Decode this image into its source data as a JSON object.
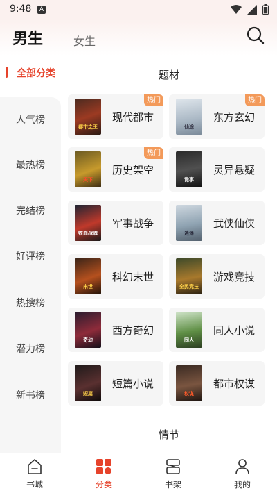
{
  "status_bar": {
    "time": "9:48",
    "notification_icon": "A"
  },
  "header": {
    "tab_male": "男生",
    "tab_female": "女生",
    "search_icon": "search-icon"
  },
  "sidebar": {
    "active_label": "全部分类",
    "items": [
      "人气榜",
      "最热榜",
      "完结榜",
      "好评榜",
      "热搜榜",
      "潜力榜",
      "新书榜"
    ]
  },
  "sections": {
    "genre_title": "题材",
    "plot_title": "情节"
  },
  "categories": [
    {
      "label": "现代都市",
      "hot": "热门",
      "cover_text": "都市之王"
    },
    {
      "label": "东方玄幻",
      "hot": "热门",
      "cover_text": "仙途"
    },
    {
      "label": "历史架空",
      "hot": "热门",
      "cover_text": "天下"
    },
    {
      "label": "灵异悬疑",
      "hot": "",
      "cover_text": "诡事"
    },
    {
      "label": "军事战争",
      "hot": "",
      "cover_text": "铁血战魂"
    },
    {
      "label": "武侠仙侠",
      "hot": "",
      "cover_text": "逍遥"
    },
    {
      "label": "科幻末世",
      "hot": "",
      "cover_text": "末世"
    },
    {
      "label": "游戏竞技",
      "hot": "",
      "cover_text": "全民竞技"
    },
    {
      "label": "西方奇幻",
      "hot": "",
      "cover_text": "奇幻"
    },
    {
      "label": "同人小说",
      "hot": "",
      "cover_text": "同人"
    },
    {
      "label": "短篇小说",
      "hot": "",
      "cover_text": "短篇"
    },
    {
      "label": "都市权谋",
      "hot": "",
      "cover_text": "权谋"
    }
  ],
  "bottom_nav": [
    {
      "label": "书城",
      "icon": "home-icon",
      "active": false
    },
    {
      "label": "分类",
      "icon": "category-icon",
      "active": true
    },
    {
      "label": "书架",
      "icon": "bookshelf-icon",
      "active": false
    },
    {
      "label": "我的",
      "icon": "profile-icon",
      "active": false
    }
  ],
  "colors": {
    "accent": "#e6432b",
    "hot_badge": "#f39a5a",
    "card_bg": "#f5f5f5",
    "sidebar_bg": "#f6f6f6"
  }
}
